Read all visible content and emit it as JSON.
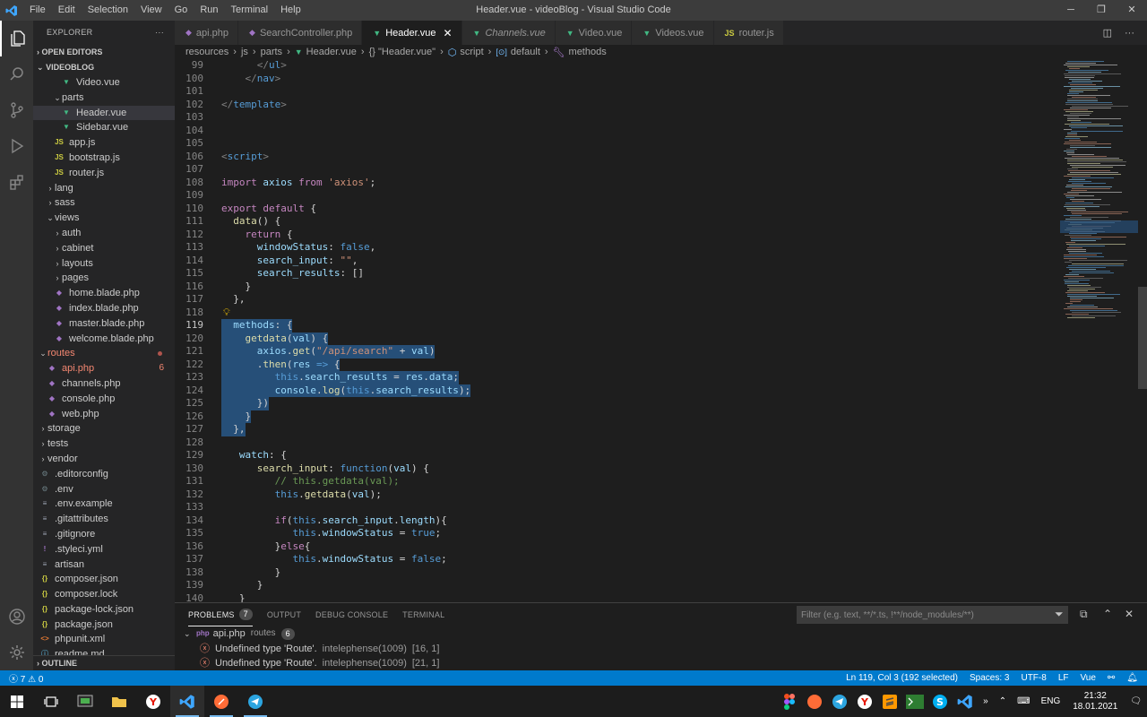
{
  "window": {
    "title": "Header.vue - videoBlog - Visual Studio Code",
    "menu": [
      "File",
      "Edit",
      "Selection",
      "View",
      "Go",
      "Run",
      "Terminal",
      "Help"
    ]
  },
  "sidebar": {
    "header": "EXPLORER",
    "open_editors": "OPEN EDITORS",
    "project": "VIDEOBLOG",
    "outline": "OUTLINE",
    "tree": [
      {
        "label": "Video.vue",
        "icon": "vue-icon",
        "indent": 3,
        "kind": "file"
      },
      {
        "label": "parts",
        "icon": "folder",
        "indent": 2,
        "kind": "folder-open"
      },
      {
        "label": "Header.vue",
        "icon": "vue-icon",
        "indent": 3,
        "kind": "file",
        "selected": true
      },
      {
        "label": "Sidebar.vue",
        "icon": "vue-icon",
        "indent": 3,
        "kind": "file"
      },
      {
        "label": "app.js",
        "icon": "js-icon",
        "indent": 2,
        "kind": "file"
      },
      {
        "label": "bootstrap.js",
        "icon": "js-icon",
        "indent": 2,
        "kind": "file"
      },
      {
        "label": "router.js",
        "icon": "js-icon",
        "indent": 2,
        "kind": "file"
      },
      {
        "label": "lang",
        "icon": "folder",
        "indent": 1,
        "kind": "folder"
      },
      {
        "label": "sass",
        "icon": "folder",
        "indent": 1,
        "kind": "folder"
      },
      {
        "label": "views",
        "icon": "folder",
        "indent": 1,
        "kind": "folder-open"
      },
      {
        "label": "auth",
        "icon": "folder",
        "indent": 2,
        "kind": "folder"
      },
      {
        "label": "cabinet",
        "icon": "folder",
        "indent": 2,
        "kind": "folder"
      },
      {
        "label": "layouts",
        "icon": "folder",
        "indent": 2,
        "kind": "folder"
      },
      {
        "label": "pages",
        "icon": "folder",
        "indent": 2,
        "kind": "folder"
      },
      {
        "label": "home.blade.php",
        "icon": "php-icon",
        "indent": 2,
        "kind": "file"
      },
      {
        "label": "index.blade.php",
        "icon": "php-icon",
        "indent": 2,
        "kind": "file"
      },
      {
        "label": "master.blade.php",
        "icon": "php-icon",
        "indent": 2,
        "kind": "file"
      },
      {
        "label": "welcome.blade.php",
        "icon": "php-icon",
        "indent": 2,
        "kind": "file"
      },
      {
        "label": "routes",
        "icon": "folder",
        "indent": 0,
        "kind": "folder-open",
        "error": true,
        "dot": true
      },
      {
        "label": "api.php",
        "icon": "php-icon",
        "indent": 1,
        "kind": "file",
        "error": true,
        "badge": "6"
      },
      {
        "label": "channels.php",
        "icon": "php-icon",
        "indent": 1,
        "kind": "file"
      },
      {
        "label": "console.php",
        "icon": "php-icon",
        "indent": 1,
        "kind": "file"
      },
      {
        "label": "web.php",
        "icon": "php-icon",
        "indent": 1,
        "kind": "file"
      },
      {
        "label": "storage",
        "icon": "folder",
        "indent": 0,
        "kind": "folder"
      },
      {
        "label": "tests",
        "icon": "folder",
        "indent": 0,
        "kind": "folder"
      },
      {
        "label": "vendor",
        "icon": "folder",
        "indent": 0,
        "kind": "folder"
      },
      {
        "label": ".editorconfig",
        "icon": "gear-icon",
        "indent": 0,
        "kind": "file"
      },
      {
        "label": ".env",
        "icon": "gear-icon",
        "indent": 0,
        "kind": "file"
      },
      {
        "label": ".env.example",
        "icon": "lines-icon",
        "indent": 0,
        "kind": "file"
      },
      {
        "label": ".gitattributes",
        "icon": "lines-icon",
        "indent": 0,
        "kind": "file"
      },
      {
        "label": ".gitignore",
        "icon": "lines-icon",
        "indent": 0,
        "kind": "file"
      },
      {
        "label": ".styleci.yml",
        "icon": "yml-icon",
        "indent": 0,
        "kind": "file"
      },
      {
        "label": "artisan",
        "icon": "lines-icon",
        "indent": 0,
        "kind": "file"
      },
      {
        "label": "composer.json",
        "icon": "json-icon",
        "indent": 0,
        "kind": "file"
      },
      {
        "label": "composer.lock",
        "icon": "json-icon",
        "indent": 0,
        "kind": "file"
      },
      {
        "label": "package-lock.json",
        "icon": "json-icon",
        "indent": 0,
        "kind": "file"
      },
      {
        "label": "package.json",
        "icon": "json-icon",
        "indent": 0,
        "kind": "file"
      },
      {
        "label": "phpunit.xml",
        "icon": "xml-icon",
        "indent": 0,
        "kind": "file"
      },
      {
        "label": "readme.md",
        "icon": "md-icon",
        "indent": 0,
        "kind": "file"
      }
    ]
  },
  "tabs": [
    {
      "label": "api.php",
      "icon": "php-icon",
      "active": false
    },
    {
      "label": "SearchController.php",
      "icon": "php-icon",
      "active": false
    },
    {
      "label": "Header.vue",
      "icon": "vue-icon",
      "active": true
    },
    {
      "label": "Channels.vue",
      "icon": "vue-icon",
      "active": false,
      "italic": true
    },
    {
      "label": "Video.vue",
      "icon": "vue-icon",
      "active": false
    },
    {
      "label": "Videos.vue",
      "icon": "vue-icon",
      "active": false
    },
    {
      "label": "router.js",
      "icon": "js-icon",
      "active": false
    }
  ],
  "breadcrumb": [
    "resources",
    "js",
    "parts",
    "Header.vue",
    "{} \"Header.vue\"",
    "script",
    "default",
    "methods"
  ],
  "editor": {
    "current_line": 119,
    "lines": [
      {
        "n": 99,
        "tokens": [
          [
            "p",
            "      "
          ],
          [
            "t",
            "</"
          ],
          [
            "tagn",
            "ul"
          ],
          [
            "t",
            ">"
          ]
        ]
      },
      {
        "n": 100,
        "tokens": [
          [
            "p",
            "    "
          ],
          [
            "t",
            "</"
          ],
          [
            "tagn",
            "nav"
          ],
          [
            "t",
            ">"
          ]
        ]
      },
      {
        "n": 101,
        "tokens": []
      },
      {
        "n": 102,
        "tokens": [
          [
            "t",
            "</"
          ],
          [
            "tagn",
            "template"
          ],
          [
            "t",
            ">"
          ]
        ]
      },
      {
        "n": 103,
        "tokens": []
      },
      {
        "n": 104,
        "tokens": []
      },
      {
        "n": 105,
        "tokens": []
      },
      {
        "n": 106,
        "tokens": [
          [
            "t",
            "<"
          ],
          [
            "tagn",
            "script"
          ],
          [
            "t",
            ">"
          ]
        ]
      },
      {
        "n": 107,
        "tokens": []
      },
      {
        "n": 108,
        "tokens": [
          [
            "kc",
            "import"
          ],
          [
            "p",
            " "
          ],
          [
            "v",
            "axios"
          ],
          [
            "p",
            " "
          ],
          [
            "kc",
            "from"
          ],
          [
            "p",
            " "
          ],
          [
            "s",
            "'axios'"
          ],
          [
            "p",
            ";"
          ]
        ]
      },
      {
        "n": 109,
        "tokens": []
      },
      {
        "n": 110,
        "tokens": [
          [
            "kc",
            "export"
          ],
          [
            "p",
            " "
          ],
          [
            "kc",
            "default"
          ],
          [
            "p",
            " {"
          ]
        ]
      },
      {
        "n": 111,
        "tokens": [
          [
            "p",
            "  "
          ],
          [
            "f",
            "data"
          ],
          [
            "p",
            "() {"
          ]
        ]
      },
      {
        "n": 112,
        "tokens": [
          [
            "p",
            "    "
          ],
          [
            "kc",
            "return"
          ],
          [
            "p",
            " {"
          ]
        ]
      },
      {
        "n": 113,
        "tokens": [
          [
            "p",
            "      "
          ],
          [
            "v",
            "windowStatus"
          ],
          [
            "p",
            ": "
          ],
          [
            "k",
            "false"
          ],
          [
            "p",
            ","
          ]
        ]
      },
      {
        "n": 114,
        "tokens": [
          [
            "p",
            "      "
          ],
          [
            "v",
            "search_input"
          ],
          [
            "p",
            ": "
          ],
          [
            "s",
            "\"\""
          ],
          [
            "p",
            ","
          ]
        ]
      },
      {
        "n": 115,
        "tokens": [
          [
            "p",
            "      "
          ],
          [
            "v",
            "search_results"
          ],
          [
            "p",
            ": []"
          ]
        ]
      },
      {
        "n": 116,
        "tokens": [
          [
            "p",
            "    }"
          ]
        ]
      },
      {
        "n": 117,
        "tokens": [
          [
            "p",
            "  },"
          ]
        ]
      },
      {
        "n": 118,
        "tokens": [],
        "bulb": true
      },
      {
        "n": 119,
        "sel": true,
        "tokens": [
          [
            "p",
            "  "
          ],
          [
            "v",
            "methods"
          ],
          [
            "p",
            ": {"
          ]
        ]
      },
      {
        "n": 120,
        "sel": true,
        "tokens": [
          [
            "p",
            "    "
          ],
          [
            "f",
            "getdata"
          ],
          [
            "p",
            "("
          ],
          [
            "v",
            "val"
          ],
          [
            "p",
            ") {"
          ]
        ]
      },
      {
        "n": 121,
        "sel": true,
        "tokens": [
          [
            "p",
            "      "
          ],
          [
            "v",
            "axios"
          ],
          [
            "p",
            "."
          ],
          [
            "f",
            "get"
          ],
          [
            "p",
            "("
          ],
          [
            "s",
            "\"/api/search\""
          ],
          [
            "p",
            " + "
          ],
          [
            "v",
            "val"
          ],
          [
            "p",
            ")"
          ]
        ]
      },
      {
        "n": 122,
        "sel": true,
        "tokens": [
          [
            "p",
            "      ."
          ],
          [
            "f",
            "then"
          ],
          [
            "p",
            "("
          ],
          [
            "v",
            "res"
          ],
          [
            "p",
            " "
          ],
          [
            "k",
            "=>"
          ],
          [
            "p",
            " {"
          ]
        ]
      },
      {
        "n": 123,
        "sel": true,
        "tokens": [
          [
            "p",
            "         "
          ],
          [
            "k",
            "this"
          ],
          [
            "p",
            "."
          ],
          [
            "v",
            "search_results"
          ],
          [
            "p",
            " = "
          ],
          [
            "v",
            "res"
          ],
          [
            "p",
            "."
          ],
          [
            "v",
            "data"
          ],
          [
            "p",
            ";"
          ]
        ]
      },
      {
        "n": 124,
        "sel": true,
        "tokens": [
          [
            "p",
            "         "
          ],
          [
            "v",
            "console"
          ],
          [
            "p",
            "."
          ],
          [
            "f",
            "log"
          ],
          [
            "p",
            "("
          ],
          [
            "k",
            "this"
          ],
          [
            "p",
            "."
          ],
          [
            "v",
            "search_results"
          ],
          [
            "p",
            ");"
          ]
        ]
      },
      {
        "n": 125,
        "sel": true,
        "tokens": [
          [
            "p",
            "      })"
          ]
        ]
      },
      {
        "n": 126,
        "sel": true,
        "tokens": [
          [
            "p",
            "    }"
          ]
        ]
      },
      {
        "n": 127,
        "sel": true,
        "tokens": [
          [
            "p",
            "  },"
          ]
        ]
      },
      {
        "n": 128,
        "tokens": []
      },
      {
        "n": 129,
        "tokens": [
          [
            "p",
            "   "
          ],
          [
            "v",
            "watch"
          ],
          [
            "p",
            ": {"
          ]
        ]
      },
      {
        "n": 130,
        "tokens": [
          [
            "p",
            "      "
          ],
          [
            "f",
            "search_input"
          ],
          [
            "p",
            ": "
          ],
          [
            "k",
            "function"
          ],
          [
            "p",
            "("
          ],
          [
            "v",
            "val"
          ],
          [
            "p",
            ") {"
          ]
        ]
      },
      {
        "n": 131,
        "tokens": [
          [
            "p",
            "         "
          ],
          [
            "c",
            "// this.getdata(val);"
          ]
        ]
      },
      {
        "n": 132,
        "tokens": [
          [
            "p",
            "         "
          ],
          [
            "k",
            "this"
          ],
          [
            "p",
            "."
          ],
          [
            "f",
            "getdata"
          ],
          [
            "p",
            "("
          ],
          [
            "v",
            "val"
          ],
          [
            "p",
            ");"
          ]
        ]
      },
      {
        "n": 133,
        "tokens": []
      },
      {
        "n": 134,
        "tokens": [
          [
            "p",
            "         "
          ],
          [
            "kc",
            "if"
          ],
          [
            "p",
            "("
          ],
          [
            "k",
            "this"
          ],
          [
            "p",
            "."
          ],
          [
            "v",
            "search_input"
          ],
          [
            "p",
            "."
          ],
          [
            "v",
            "length"
          ],
          [
            "p",
            "){"
          ]
        ]
      },
      {
        "n": 135,
        "tokens": [
          [
            "p",
            "            "
          ],
          [
            "k",
            "this"
          ],
          [
            "p",
            "."
          ],
          [
            "v",
            "windowStatus"
          ],
          [
            "p",
            " = "
          ],
          [
            "k",
            "true"
          ],
          [
            "p",
            ";"
          ]
        ]
      },
      {
        "n": 136,
        "tokens": [
          [
            "p",
            "         }"
          ],
          [
            "kc",
            "else"
          ],
          [
            "p",
            "{"
          ]
        ]
      },
      {
        "n": 137,
        "tokens": [
          [
            "p",
            "            "
          ],
          [
            "k",
            "this"
          ],
          [
            "p",
            "."
          ],
          [
            "v",
            "windowStatus"
          ],
          [
            "p",
            " = "
          ],
          [
            "k",
            "false"
          ],
          [
            "p",
            ";"
          ]
        ]
      },
      {
        "n": 138,
        "tokens": [
          [
            "p",
            "         }"
          ]
        ]
      },
      {
        "n": 139,
        "tokens": [
          [
            "p",
            "      }"
          ]
        ]
      },
      {
        "n": 140,
        "tokens": [
          [
            "p",
            "   }"
          ]
        ]
      }
    ]
  },
  "panel": {
    "tabs": [
      {
        "label": "PROBLEMS",
        "count": "7",
        "active": true
      },
      {
        "label": "OUTPUT",
        "active": false
      },
      {
        "label": "DEBUG CONSOLE",
        "active": false
      },
      {
        "label": "TERMINAL",
        "active": false
      }
    ],
    "filter_placeholder": "Filter (e.g. text, **/*.ts, !**/node_modules/**)",
    "group": {
      "file": "api.php",
      "folder": "routes",
      "count": "6"
    },
    "problems": [
      {
        "message": "Undefined type 'Route'.",
        "source": "intelephense(1009)",
        "pos": "[16, 1]"
      },
      {
        "message": "Undefined type 'Route'.",
        "source": "intelephense(1009)",
        "pos": "[21, 1]"
      }
    ]
  },
  "statusbar": {
    "errors": "7",
    "warnings": "0",
    "position": "Ln 119, Col 3 (192 selected)",
    "spaces": "Spaces: 3",
    "encoding": "UTF-8",
    "eol": "LF",
    "language": "Vue"
  },
  "taskbar": {
    "lang": "ENG",
    "time": "21:32",
    "date": "18.01.2021"
  },
  "colors": {
    "accent": "#007acc",
    "vue": "#41b883",
    "js": "#cbcb41",
    "php": "#a074c4",
    "error": "#f48771"
  }
}
